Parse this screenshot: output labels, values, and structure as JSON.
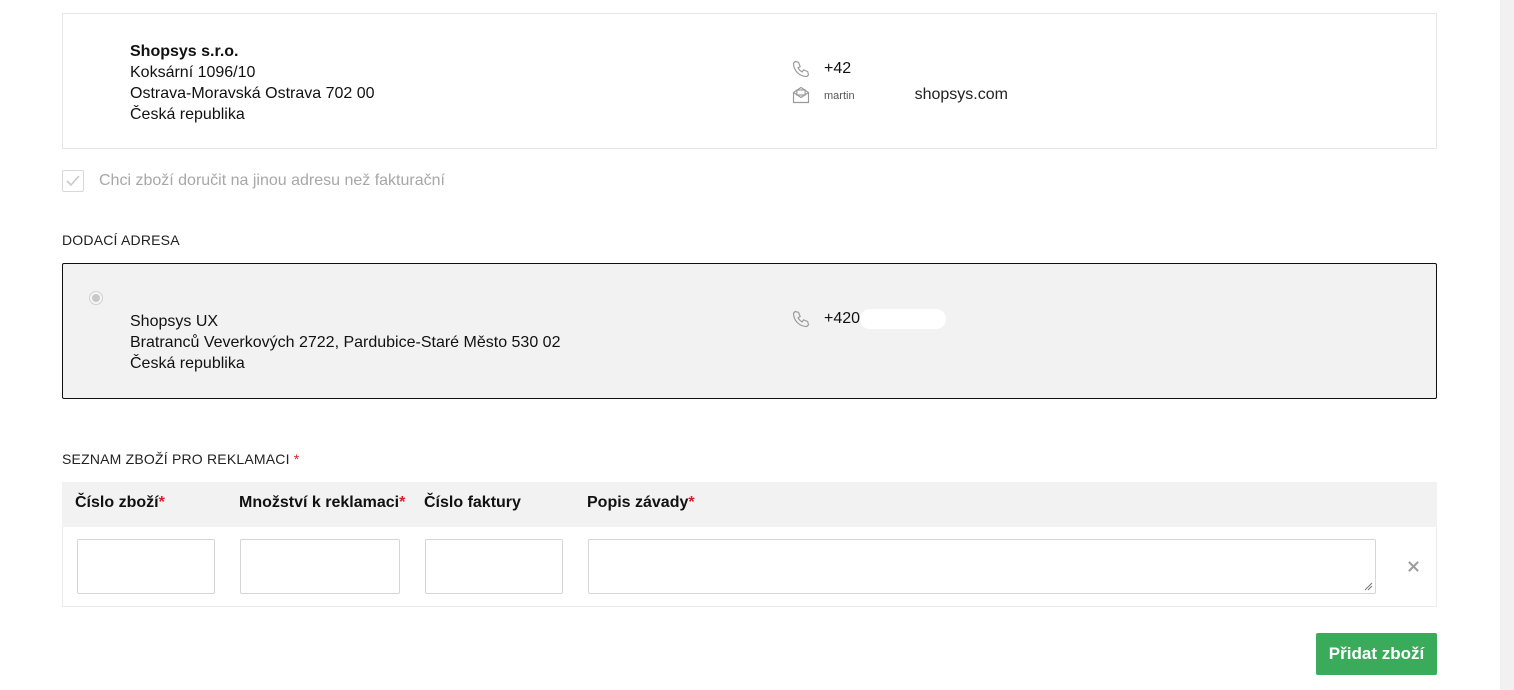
{
  "billing": {
    "name": "Shopsys s.r.o.",
    "street": "Koksární 1096/10",
    "city": "Ostrava-Moravská Ostrava 702 00",
    "country": "Česká republika",
    "phone": "+42",
    "email_prefix": "martin",
    "email_suffix": "shopsys.com",
    "phone_icon": "phone-icon",
    "email_icon": "envelope-icon"
  },
  "different_address": {
    "label": "Chci zboží doručit na jinou adresu než fakturační",
    "checked": true
  },
  "delivery": {
    "section_label": "DODACÍ ADRESA",
    "name": "Shopsys UX",
    "street_city": "Bratranců Veverkových 2722, Pardubice-Staré Město 530 02",
    "country": "Česká republika",
    "phone": "+420"
  },
  "items": {
    "section_label": "SEZNAM ZBOŽÍ PRO REKLAMACI",
    "required_mark": "*",
    "columns": [
      {
        "label": "Číslo zboží",
        "required": "*"
      },
      {
        "label": "Množství k reklamaci",
        "required": "*"
      },
      {
        "label": "Číslo faktury",
        "required": ""
      },
      {
        "label": "Popis závady",
        "required": "*"
      }
    ],
    "row": {
      "product_number": "",
      "quantity": "",
      "invoice_number": "",
      "description": "",
      "remove_icon": "close-icon"
    }
  },
  "add_button": "Přidat zboží",
  "colors": {
    "accent": "#3aaa5b",
    "required": "#d02026",
    "panel": "#f2f2f2"
  }
}
